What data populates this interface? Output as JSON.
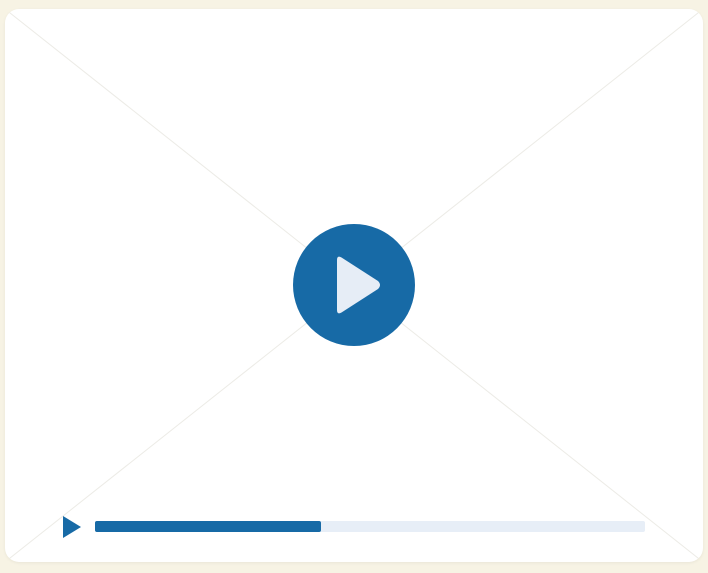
{
  "player": {
    "state": "paused",
    "progress_fraction": 0.41
  },
  "icons": {
    "big_play": "play-icon",
    "small_play": "play-icon",
    "placeholder": "video-placeholder-cross"
  },
  "colors": {
    "background": "#f7f3e4",
    "surface": "#ffffff",
    "accent": "#176aa6",
    "track": "#e7eef7",
    "play_glyph": "#e6edf6",
    "placeholder_lines": "#ecebe6"
  }
}
